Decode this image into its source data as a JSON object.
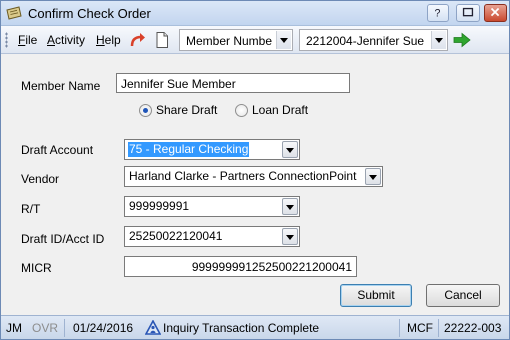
{
  "window": {
    "title": "Confirm Check Order"
  },
  "toolbar": {
    "menus": [
      {
        "label": "File",
        "accel": "F",
        "rest": "ile"
      },
      {
        "label": "Activity",
        "accel": "A",
        "rest": "ctivity"
      },
      {
        "label": "Help",
        "accel": "H",
        "rest": "elp"
      }
    ],
    "search_field": "Member Numbe",
    "member_select": "2212004-Jennifer Sue"
  },
  "form": {
    "member_name_label": "Member Name",
    "member_name_value": "Jennifer Sue Member",
    "radio_share": "Share Draft",
    "radio_loan": "Loan Draft",
    "selected_draft_type": "Share Draft",
    "draft_account_label": "Draft Account",
    "draft_account_value": "75 - Regular Checking",
    "vendor_label": "Vendor",
    "vendor_value": "Harland Clarke - Partners ConnectionPoint",
    "rt_label": "R/T",
    "rt_value": "999999991",
    "draft_id_label": "Draft ID/Acct ID",
    "draft_id_value": "25250022120041",
    "micr_label": "MICR",
    "micr_value": "999999991252500221200041",
    "submit_label": "Submit",
    "cancel_label": "Cancel"
  },
  "status": {
    "user": "JM",
    "ovr": "OVR",
    "date": "01/24/2016",
    "message": "Inquiry Transaction Complete",
    "mode": "MCF",
    "code": "22222-003"
  },
  "colors": {
    "accent": "#3399ff",
    "titlebar": "#c2d5ef",
    "ovr_disabled": "#8d8d8d",
    "go_arrow": "#2fa52f",
    "redo_arrow": "#d9412a"
  }
}
